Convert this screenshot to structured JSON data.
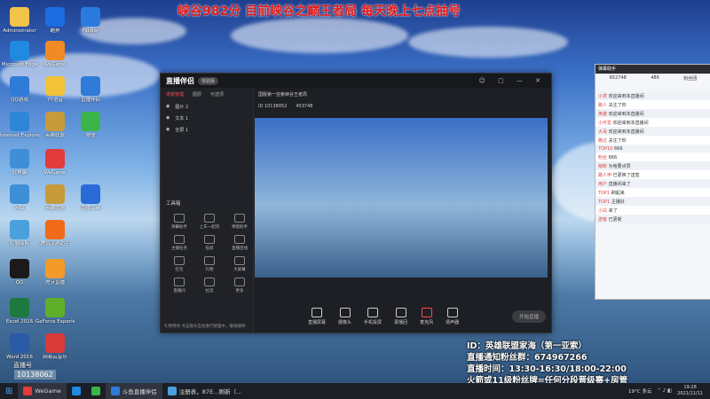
{
  "headline": "峡谷982分 目前峡谷之巅王者局 每天晚上七点抽号",
  "desktop_icons": [
    {
      "label": "Administrator",
      "color": "#f2c44a"
    },
    {
      "label": "Microsoft Edge",
      "color": "#1f8ae0"
    },
    {
      "label": "QQ游戏",
      "color": "#2f7bd8"
    },
    {
      "label": "Internet Explorer",
      "color": "#2e86d6"
    },
    {
      "label": "此电脑",
      "color": "#3f8fd6"
    },
    {
      "label": "网络",
      "color": "#3f8fd6"
    },
    {
      "label": "控制面板",
      "color": "#4aa0dd"
    },
    {
      "label": "QQ",
      "color": "#1a1a1a"
    },
    {
      "label": "Excel 2016",
      "color": "#1d7a3e"
    },
    {
      "label": "Word 2016",
      "color": "#2a5aa6"
    },
    {
      "label": "酷狗",
      "color": "#1b6de0"
    },
    {
      "label": "WeGame",
      "color": "#f08a24"
    },
    {
      "label": "YY语音",
      "color": "#f2c338"
    },
    {
      "label": "英雄联盟",
      "color": "#c79a3a"
    },
    {
      "label": "WeGame",
      "color": "#e23b3b"
    },
    {
      "label": "英雄联盟",
      "color": "#c79a3a"
    },
    {
      "label": "腾讯手游助手",
      "color": "#f06a1a"
    },
    {
      "label": "虎牙直播",
      "color": "#f29a2a"
    },
    {
      "label": "GeForce Experience",
      "color": "#5fae2a"
    },
    {
      "label": "网易云音乐",
      "color": "#d83a3a"
    },
    {
      "label": "Fiddler",
      "color": "#2a7ae0"
    },
    {
      "label": "直播伴侣",
      "color": "#2f7bd8"
    },
    {
      "label": "微信",
      "color": "#3ab54a"
    },
    {
      "label": "直播工具",
      "color": "#2a6ad6"
    }
  ],
  "app": {
    "brand": "直播伴侣",
    "badge": "体验版",
    "left_tabs": [
      "场景管理",
      "图层",
      "可选项"
    ],
    "sources": [
      "图片 2",
      "文本 1",
      "全屏 1"
    ],
    "tools_title": "工具箱",
    "tools": [
      "弹幕助手",
      "上车一起玩",
      "弹窗助手",
      "主播任务",
      "投屏",
      "直播连线",
      "红包",
      "礼物",
      "大屏幕",
      "直播间",
      "拉流",
      "更多"
    ],
    "stream_title": "国服第一亚索峡谷王者局",
    "fans": "10138052",
    "viewers": "453748",
    "bottom_buttons": [
      "直播屏幕",
      "摄像头",
      "手机投屏",
      "录播回",
      "麦克风",
      "扬声器"
    ],
    "start_button": "开始直播",
    "status": "礼物特效   点击观众互动进行管理中，敬请期待"
  },
  "chat": {
    "title": "弹幕助手",
    "stats": [
      "652748",
      "486",
      "粉丝团"
    ],
    "messages": [
      {
        "user": "小草",
        "text": "欢迎来到本直播间"
      },
      {
        "user": "路人",
        "text": "关注了你"
      },
      {
        "user": "英雄",
        "text": "欢迎来到本直播间"
      },
      {
        "user": "小可爱",
        "text": "欢迎来到本直播间"
      },
      {
        "user": "大哥",
        "text": "欢迎来到本直播间"
      },
      {
        "user": "路过",
        "text": "关注了你"
      },
      {
        "user": "TOP10",
        "text": "666"
      },
      {
        "user": "粉丝",
        "text": "666"
      },
      {
        "user": "萌新",
        "text": "为啥要点赞"
      },
      {
        "user": "路人甲",
        "text": "已更换了送签"
      },
      {
        "user": "用户",
        "text": "直播间来了"
      },
      {
        "user": "TOP1",
        "text": "刷起来"
      },
      {
        "user": "TOP1",
        "text": "主播好"
      },
      {
        "user": "小白",
        "text": "来了"
      },
      {
        "user": "游客",
        "text": "已更新"
      }
    ]
  },
  "info_lines": [
    "ID：英雄联盟家海（第一亚索）",
    "直播通知粉丝群：674967266",
    "直播时间：13:30-16:30/18:00-22:00",
    "火箭或11级粉丝牌=任何分段晋级赛+房管"
  ],
  "room": {
    "name": "直播号",
    "number": "10138062"
  },
  "taskbar": {
    "items": [
      "WeGame",
      "斗鱼直播伴侣",
      "注册表，87E…刷新（…"
    ],
    "weather": "19°C 多云",
    "time": "19:28",
    "date": "2021/11/11"
  }
}
